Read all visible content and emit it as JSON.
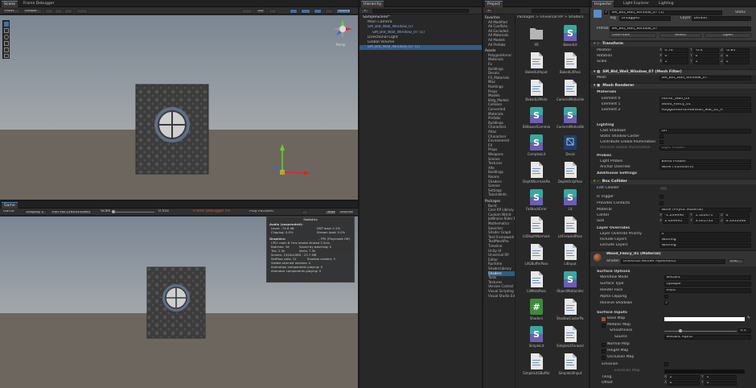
{
  "scene": {
    "tabs": [
      "Scene",
      "Frame Debugger"
    ],
    "toolbar": [
      "Pivot",
      "Global",
      "2D",
      "Gizmos"
    ],
    "persp_label": "Persp"
  },
  "game": {
    "tab": "Game",
    "toolbar": {
      "display": "Game",
      "display_num": "Display 1",
      "resolution": "Full HD (1920x1080)",
      "scale_label": "Scale",
      "scale_value": "0.55x",
      "debugger": "Frame Debugger On",
      "play": "Play Focused",
      "stats": "Stats",
      "gizmos": "Gizmos"
    },
    "stats": {
      "title": "Statistics",
      "audio_title": "Audio (suspended):",
      "level": "Level: -74.8 dB",
      "dsp": "DSP load: 0.1%",
      "clipping": "Clipping: 0.0%",
      "stream": "Stream load: 0.0%",
      "graphics": "Graphics:",
      "fps": "- FPS (Playmode Off)",
      "cpu": "CPU: main 8.7ms  render thread 3.2ms",
      "batches": "Batches: 16",
      "saved": "Saved by batching: 0",
      "tris": "Tris: 2.3k",
      "verts": "Verts: 7.3k",
      "screen": "Screen: 1920x1080 - 23.7 MB",
      "setpass": "SetPass calls: 11",
      "shadow": "Shadow casters: 3",
      "skinned": "Visible skinned meshes: 0",
      "anim": "Animation components playing: 0",
      "animators": "Animator components playing: 0"
    }
  },
  "hierarchy": {
    "tab": "Hierarchy",
    "items": [
      {
        "label": "SampleScene*",
        "depth": 0
      },
      {
        "label": "Main Camera",
        "depth": 1
      },
      {
        "label": "SM_Bld_Wall_Window_07",
        "depth": 1,
        "blue": true
      },
      {
        "label": "SM_Bld_Wall_Window_07 (1)",
        "depth": 2,
        "blue": true
      },
      {
        "label": "Directional Light",
        "depth": 1
      },
      {
        "label": "Global Volume",
        "depth": 1
      },
      {
        "label": "SM_Bld_Wall_Window_07 (1)",
        "depth": 1,
        "blue": true,
        "selected": true
      }
    ]
  },
  "project": {
    "tab": "Project",
    "breadcrumb": "Packages > Universal RP > Shaders",
    "favorites": [
      "Favorites",
      "All Modified",
      "All Conflicts",
      "All Excluded",
      "All Materials",
      "All Models",
      "All Prefabs"
    ],
    "assets": [
      "Assets",
      "PolygonHorror",
      "Materials",
      "Fx",
      "Buildings",
      "Decals",
      "FX_Materials",
      "Misc",
      "Paintings",
      "Props",
      "Models",
      "Bldg_Models",
      "Collision",
      "Converted",
      "Materials",
      "Prefabs",
      "Buildings",
      "Characters",
      "Atlas",
      "Characters",
      "Environment",
      "FX",
      "Props",
      "Weapons",
      "Scenes",
      "Textures",
      "Alts",
      "Buildings",
      "Rooms",
      "Shaders",
      "Scenes",
      "Settings",
      "TutorialInfo"
    ],
    "packages": [
      "Packages",
      "Burst",
      "Core RP Library",
      "Custom NUnit",
      "JetBrains Rider Editor",
      "Mathematics",
      "Searcher",
      "Shader Graph",
      "Test Framework",
      "TextMeshPro",
      "Timeline",
      "Unity UI",
      "Universal RP",
      "Editor",
      "Runtime",
      "ShaderLibrary",
      "Shaders",
      "Tests",
      "Textures",
      "Version Control",
      "Visual Scripting",
      "Visual Studio Editor"
    ],
    "files": [
      {
        "name": "XR",
        "kind": "folder"
      },
      {
        "name": "BakedLit",
        "kind": "shadergraph"
      },
      {
        "name": "BakedLitInput",
        "kind": "doc"
      },
      {
        "name": "BakedLitPass",
        "kind": "doc"
      },
      {
        "name": "BakedLitMeta",
        "kind": "doc"
      },
      {
        "name": "CameraMotionVectors",
        "kind": "doc"
      },
      {
        "name": "BillboardCommon",
        "kind": "shadergraph"
      },
      {
        "name": "CameraMotionBlur",
        "kind": "shadergraph"
      },
      {
        "name": "ComplexLit",
        "kind": "shadergraph"
      },
      {
        "name": "Decal",
        "kind": "decal"
      },
      {
        "name": "DepthNormalsPass",
        "kind": "doc"
      },
      {
        "name": "DepthOnlyPass",
        "kind": "doc"
      },
      {
        "name": "FallbackError",
        "kind": "shadergraph"
      },
      {
        "name": "Lit",
        "kind": "shadergraph"
      },
      {
        "name": "LitDepthNormalsPass",
        "kind": "doc"
      },
      {
        "name": "LitForwardPass",
        "kind": "doc"
      },
      {
        "name": "LitGBufferPass",
        "kind": "doc"
      },
      {
        "name": "LitInput",
        "kind": "doc"
      },
      {
        "name": "LitMetaPass",
        "kind": "doc"
      },
      {
        "name": "ObjectMotionVectors",
        "kind": "shadergraph"
      },
      {
        "name": "Shaders",
        "kind": "csharp"
      },
      {
        "name": "ShadowCasterPass",
        "kind": "doc"
      },
      {
        "name": "SimpleLit",
        "kind": "shadergraph"
      },
      {
        "name": "SimpleLitForwardPass",
        "kind": "doc"
      },
      {
        "name": "SimpleLitGBuffer",
        "kind": "doc"
      },
      {
        "name": "SimpleLitInput",
        "kind": "doc"
      }
    ]
  },
  "inspector": {
    "tabs": [
      "Inspector",
      "Light Explorer",
      "Lighting"
    ],
    "object_name": "SM_Bld_Wall_Window_07 (1)",
    "static": "Static",
    "tag_label": "Tag",
    "tag": "Untagged",
    "layer_label": "Layer",
    "layer": "Default",
    "prefab_label": "Prefab",
    "prefab": "SM_Bld_Wall_Window_07",
    "overrides": "Overrides",
    "select": "Select",
    "open": "Open",
    "transform": {
      "title": "Transform",
      "position": {
        "label": "Position",
        "x": "0.76",
        "y": "-0.4",
        "z": "-2.81"
      },
      "rotation": {
        "label": "Rotation",
        "x": "0",
        "y": "0",
        "z": "0"
      },
      "scale": {
        "label": "Scale",
        "x": "1",
        "y": "1",
        "z": "1"
      }
    },
    "meshfilter": {
      "title": "SM_Bld_Wall_Window_07 (Mesh Filter)",
      "mesh_label": "Mesh",
      "mesh": "SM_Bld_Wall_Window_07"
    },
    "renderer": {
      "title": "Mesh Renderer",
      "materials_label": "Materials",
      "elements": [
        {
          "label": "Element 0",
          "value": "Horror_Wall_03"
        },
        {
          "label": "Element 1",
          "value": "Wood_Fancy_01"
        },
        {
          "label": "Element 2",
          "value": "PolygonHorrorMansion_Mat_01_A"
        }
      ],
      "lighting": "Lighting",
      "cast_shadows": "Cast Shadows",
      "cast_shadows_val": "On",
      "static_shadow": "Static Shadow Caster",
      "contribute_gi": "Contribute Global Illumination",
      "receive_gi": "Receive Global Illumination",
      "receive_gi_val": "Light Probes",
      "probes": "Probes",
      "light_probes": "Light Probes",
      "light_probes_val": "Blend Probes",
      "anchor": "Anchor Override",
      "anchor_val": "None (Transform)",
      "additional": "Additional Settings"
    },
    "collider": {
      "title": "Box Collider",
      "edit": "Edit Collider",
      "is_trigger": "Is Trigger",
      "provides": "Provides Contacts",
      "material_label": "Material",
      "material": "None (Physic Material)",
      "center": {
        "label": "Center",
        "x": "-1.249996",
        "y": "1.502671",
        "z": "0"
      },
      "size": {
        "label": "Size",
        "x": "2.499991",
        "y": "3.005743",
        "z": "0.3333346"
      },
      "layer_overrides": "Layer Overrides",
      "priority": "Layer Override Priority",
      "priority_val": "0",
      "include": "Include Layers",
      "include_val": "Nothing",
      "exclude": "Exclude Layers",
      "exclude_val": "Nothing"
    },
    "material": {
      "title": "Wood_Fancy_01 (Material)",
      "shader_label": "Shader",
      "shader": "Universal Render Pipeline/Lit",
      "edit": "Edit...",
      "surface_options": "Surface Options",
      "workflow": "Workflow Mode",
      "workflow_val": "Metallic",
      "surface_type": "Surface Type",
      "surface_type_val": "Opaque",
      "render_face": "Render Face",
      "render_face_val": "Front",
      "alpha_clip": "Alpha Clipping",
      "receive_shadows": "Receive Shadows",
      "surface_inputs": "Surface Inputs",
      "base_map": "Base Map",
      "metallic_map": "Metallic Map",
      "smoothness": "Smoothness",
      "smoothness_val": "0.2",
      "source": "Source",
      "source_val": "Metallic Alpha",
      "normal_map": "Normal Map",
      "height_map": "Height Map",
      "occlusion_map": "Occlusion Map",
      "emission": "Emission",
      "emission_map": "Emission Map",
      "tiling": {
        "label": "Tiling",
        "x": "1",
        "y": "1"
      },
      "offset": {
        "label": "Offset",
        "x": "0",
        "y": "0"
      }
    }
  }
}
